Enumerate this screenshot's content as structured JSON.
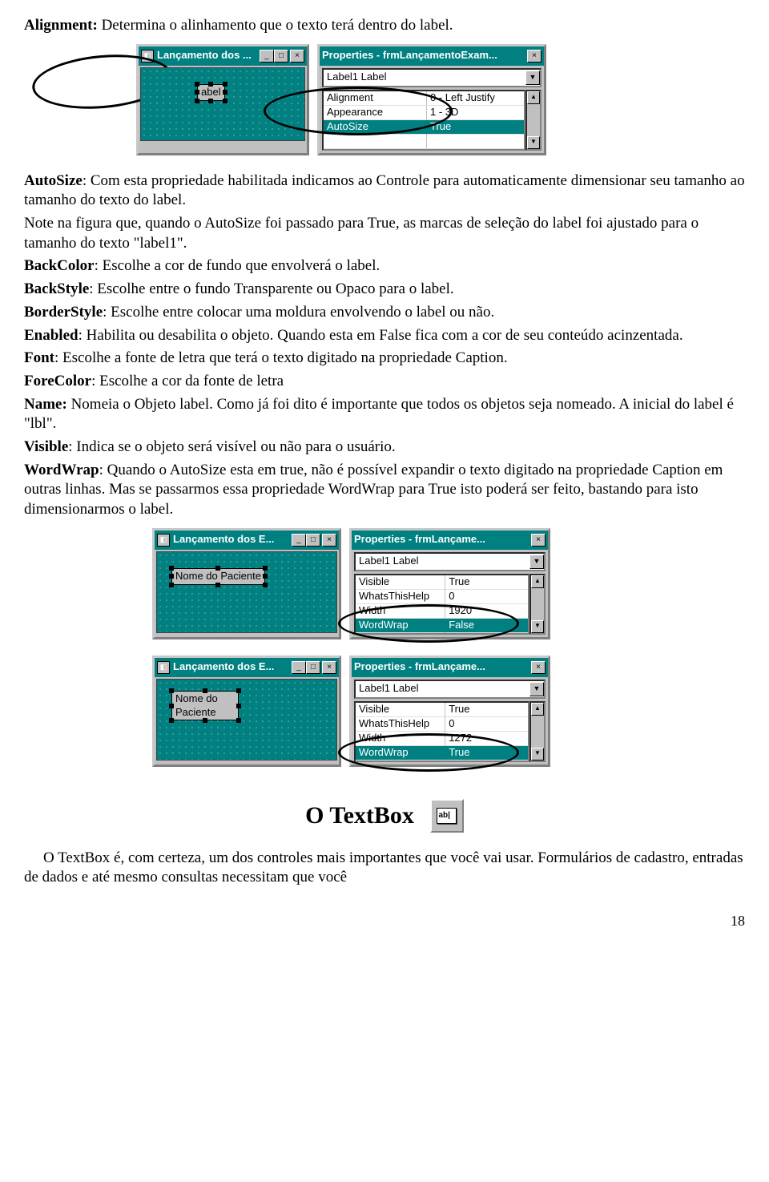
{
  "intro": {
    "alignment_label": "Alignment:",
    "alignment_text": " Determina o alinhamento que o texto terá dentro do label."
  },
  "fig1": {
    "form_title": "Lançamento dos ...",
    "label_text": "abel",
    "prop_title": "Properties - frmLançamentoExam...",
    "combo_value": "Label1 Label",
    "rows": [
      {
        "k": "Alignment",
        "v": "0 - Left Justify",
        "sel": false
      },
      {
        "k": "Appearance",
        "v": "1 - 3D",
        "sel": false
      },
      {
        "k": "AutoSize",
        "v": "True",
        "sel": true
      }
    ]
  },
  "body": {
    "autosize_label": "AutoSize",
    "autosize_text": ": Com esta propriedade habilitada indicamos ao Controle para automaticamente dimensionar seu tamanho ao tamanho do texto do label.",
    "autosize_note": "Note na figura que, quando o AutoSize foi passado para True, as marcas de seleção do label foi ajustado para o tamanho do texto \"label1\".",
    "backcolor_label": "BackColor",
    "backcolor_text": ": Escolhe a cor de fundo que envolverá o label.",
    "backstyle_label": "BackStyle",
    "backstyle_text": ": Escolhe entre o fundo Transparente ou Opaco para o label.",
    "borderstyle_label": "BorderStyle",
    "borderstyle_text": ": Escolhe entre colocar uma moldura envolvendo o label ou não.",
    "enabled_label": "Enabled",
    "enabled_text": ": Habilita ou desabilita o objeto. Quando esta em False fica com a cor de seu conteúdo acinzentada.",
    "font_label": "Font",
    "font_text": ": Escolhe a fonte de letra que terá o texto digitado na propriedade Caption.",
    "forecolor_label": "ForeColor",
    "forecolor_text": ": Escolhe a cor da fonte de letra",
    "name_label": "Name:",
    "name_text": " Nomeia o Objeto label. Como já foi dito é importante que todos os objetos seja nomeado. A inicial do label é \"lbl\".",
    "visible_label": "Visible",
    "visible_text": ": Indica se o objeto será visível ou não para o usuário.",
    "wordwrap_label": "WordWrap",
    "wordwrap_text": ": Quando o AutoSize esta em true, não é possível expandir o texto digitado na propriedade Caption em outras linhas. Mas se passarmos essa propriedade WordWrap para True isto poderá ser feito, bastando para isto dimensionarmos o label."
  },
  "fig2": {
    "form_title": "Lançamento dos E...",
    "label_text": "Nome do Paciente",
    "prop_title": "Properties - frmLançame...",
    "combo_value": "Label1 Label",
    "rows": [
      {
        "k": "Visible",
        "v": "True",
        "sel": false
      },
      {
        "k": "WhatsThisHelp",
        "v": "0",
        "sel": false
      },
      {
        "k": "Width",
        "v": "1920",
        "sel": false
      },
      {
        "k": "WordWrap",
        "v": "False",
        "sel": true
      }
    ]
  },
  "fig3": {
    "form_title": "Lançamento dos E...",
    "label_text1": "Nome do",
    "label_text2": "Paciente",
    "prop_title": "Properties - frmLançame...",
    "combo_value": "Label1 Label",
    "rows": [
      {
        "k": "Visible",
        "v": "True",
        "sel": false
      },
      {
        "k": "WhatsThisHelp",
        "v": "0",
        "sel": false
      },
      {
        "k": "Width",
        "v": "1272",
        "sel": false
      },
      {
        "k": "WordWrap",
        "v": "True",
        "sel": true
      }
    ]
  },
  "textbox_heading": "O TextBox",
  "textbox_icon_text": "ab|",
  "textbox_para": "O TextBox é, com certeza, um dos controles mais importantes que você vai usar. Formulários de cadastro, entradas de dados e até mesmo consultas necessitam que você",
  "page_number": "18"
}
